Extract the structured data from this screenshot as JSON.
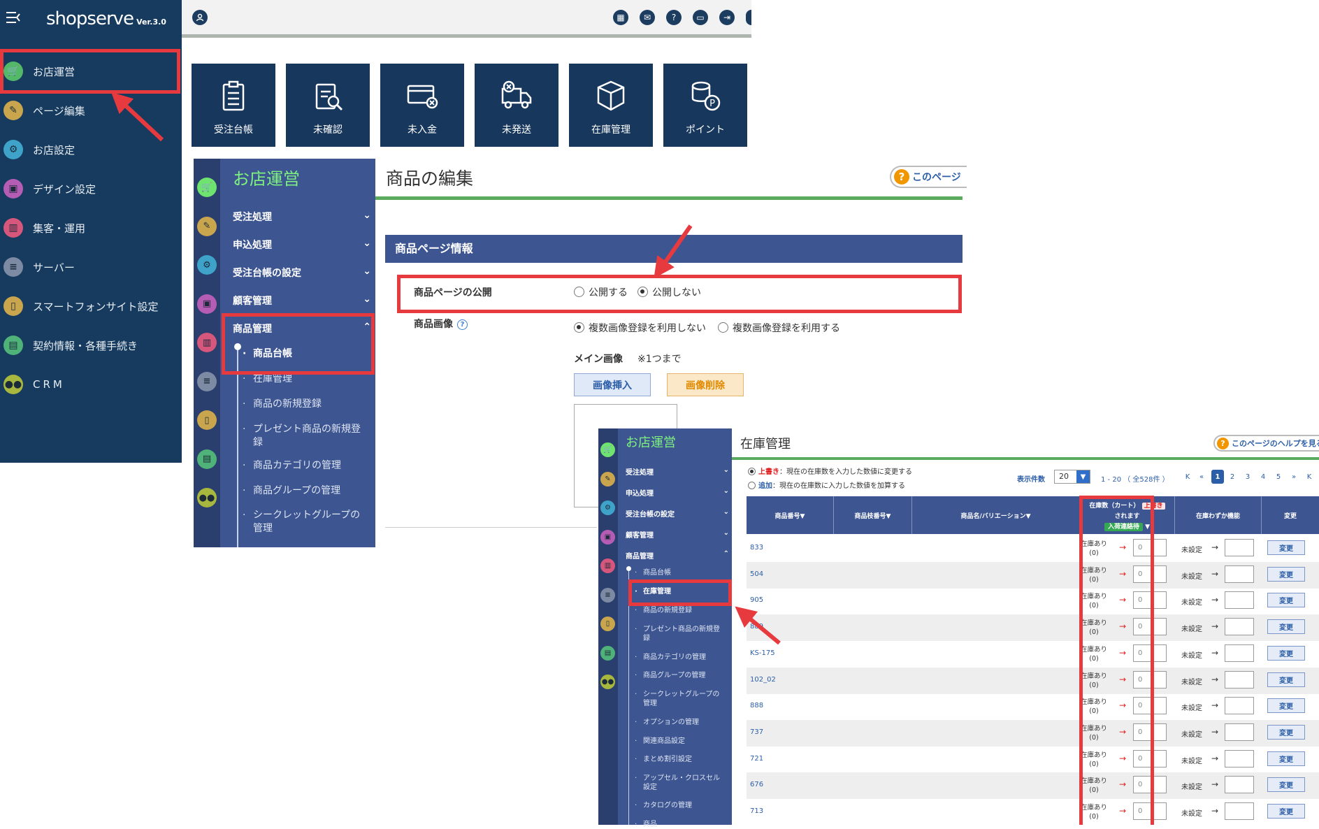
{
  "panel1": {
    "logo": "shopserve",
    "logo_ver": "Ver.3.0",
    "sidebar": [
      {
        "label": "お店運営",
        "icon": "cart-icon",
        "color": "#53b867"
      },
      {
        "label": "ページ編集",
        "icon": "edit-icon",
        "color": "#c9a64d"
      },
      {
        "label": "お店設定",
        "icon": "gear-icon",
        "color": "#3fa3c9"
      },
      {
        "label": "デザイン設定",
        "icon": "layout-icon",
        "color": "#b55db5"
      },
      {
        "label": "集客・運用",
        "icon": "bar-chart-icon",
        "color": "#d6577b"
      },
      {
        "label": "サーバー",
        "icon": "server-icon",
        "color": "#7d8aa3"
      },
      {
        "label": "スマートフォンサイト設定",
        "icon": "smartphone-icon",
        "color": "#c9a64d"
      },
      {
        "label": "契約情報・各種手続き",
        "icon": "clipboard-icon",
        "color": "#4fb279"
      },
      {
        "label": "CRM",
        "icon": "people-icon",
        "color": "#a8b83e"
      }
    ],
    "tiles": [
      {
        "label": "受注台帳",
        "icon": "order-ledger-icon"
      },
      {
        "label": "未確認",
        "icon": "unconfirmed-icon"
      },
      {
        "label": "未入金",
        "icon": "unpaid-icon"
      },
      {
        "label": "未発送",
        "icon": "unshipped-icon"
      },
      {
        "label": "在庫管理",
        "icon": "inventory-box-icon"
      },
      {
        "label": "ポイント",
        "icon": "points-icon"
      }
    ]
  },
  "panel2": {
    "menu_title": "お店運営",
    "menu": [
      {
        "label": "受注処理",
        "chevron": "⌄"
      },
      {
        "label": "申込処理",
        "chevron": "⌄"
      },
      {
        "label": "受注台帳の設定",
        "chevron": "⌄"
      },
      {
        "label": "顧客管理",
        "chevron": "⌄"
      },
      {
        "label": "商品管理",
        "chevron": "⌃"
      }
    ],
    "submenu": [
      "商品台帳",
      "在庫管理",
      "商品の新規登録",
      "プレゼント商品の新規登録",
      "商品カテゴリの管理",
      "商品グループの管理",
      "シークレットグループの管理"
    ],
    "page_title": "商品の編集",
    "help_text": "このページ",
    "section_title": "商品ページ情報",
    "publish_label": "商品ページの公開",
    "publish_options": [
      "公開する",
      "公開しない"
    ],
    "image_label": "商品画像",
    "image_options": [
      "複数画像登録を利用しない",
      "複数画像登録を利用する"
    ],
    "main_image_label": "メイン画像",
    "main_image_note": "※1つまで",
    "insert_button": "画像挿入",
    "delete_button": "画像削除"
  },
  "panel3": {
    "menu_title": "お店運営",
    "menu": [
      {
        "label": "受注処理",
        "chevron": "⌄"
      },
      {
        "label": "申込処理",
        "chevron": "⌄"
      },
      {
        "label": "受注台帳の設定",
        "chevron": "⌄"
      },
      {
        "label": "顧客管理",
        "chevron": "⌄"
      },
      {
        "label": "商品管理",
        "chevron": "⌃"
      }
    ],
    "submenu": [
      "商品台帳",
      "在庫管理",
      "商品の新規登録",
      "プレゼント商品の新規登録",
      "商品カテゴリの管理",
      "商品グループの管理",
      "シークレットグループの管理",
      "オプションの管理",
      "関連商品設定",
      "まとめ割引設定",
      "アップセル・クロスセル設定",
      "カタログの管理",
      "商品"
    ],
    "page_title": "在庫管理",
    "help_text": "このページのヘルプを見る",
    "mode_overwrite_key": "上書き",
    "mode_overwrite_desc": "：現在の在庫数を入力した数値に変更する",
    "mode_add_key": "追加",
    "mode_add_desc": "：現在の在庫数に入力した数値を加算する",
    "count_label": "表示件数",
    "count_value": "20",
    "range_text": "1 - 20 （ 全528件 ）",
    "pages": [
      "K",
      "«",
      "1",
      "2",
      "3",
      "4",
      "5",
      "»",
      "K"
    ],
    "columns": [
      "商品番号▼",
      "商品枝番号▼",
      "商品名/バリエーション▼",
      "在庫数（カート）",
      "上書き",
      "されます",
      "入荷連絡待",
      "在庫わずか機能",
      "変更"
    ],
    "rows": [
      {
        "num": "833"
      },
      {
        "num": "504"
      },
      {
        "num": "905"
      },
      {
        "num": "889"
      },
      {
        "num": "KS-175"
      },
      {
        "num": "102_02"
      },
      {
        "num": "888"
      },
      {
        "num": "737"
      },
      {
        "num": "721"
      },
      {
        "num": "676"
      },
      {
        "num": "713"
      }
    ],
    "stock_status": "在庫あり",
    "stock_count": "(0)",
    "input_placeholder": "0",
    "unset_label": "未設定",
    "change_label": "変更"
  }
}
